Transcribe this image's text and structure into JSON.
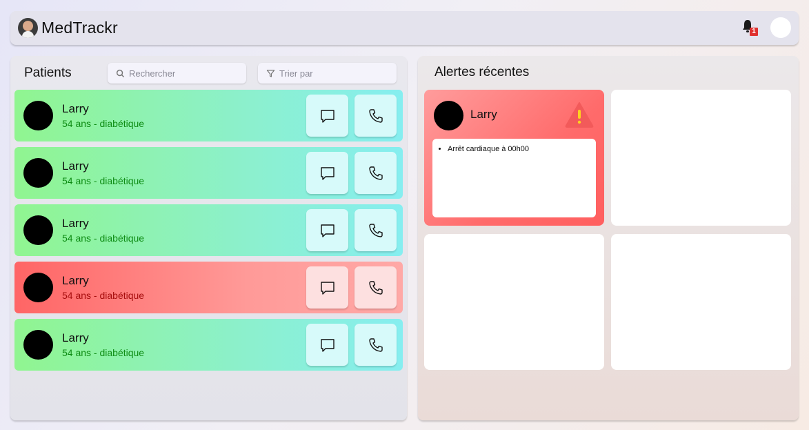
{
  "header": {
    "app_title": "MedTrackr",
    "notification_count": "1"
  },
  "patients": {
    "title": "Patients",
    "search_placeholder": "Rechercher",
    "sort_label": "Trier par",
    "rows": [
      {
        "name": "Larry",
        "info": "54 ans - diabétique",
        "status": "normal"
      },
      {
        "name": "Larry",
        "info": "54 ans - diabétique",
        "status": "normal"
      },
      {
        "name": "Larry",
        "info": "54 ans - diabétique",
        "status": "normal"
      },
      {
        "name": "Larry",
        "info": "54 ans - diabétique",
        "status": "alert"
      },
      {
        "name": "Larry",
        "info": "54 ans - diabétique",
        "status": "normal"
      }
    ]
  },
  "alerts": {
    "title": "Alertes récentes",
    "cards": [
      {
        "name": "Larry",
        "items": [
          "Arrêt cardiaque à 00h00"
        ]
      }
    ]
  },
  "colors": {
    "normal_row": "#90f590",
    "alert_row": "#ff6565",
    "normal_info": "#0e8c14",
    "alert_info": "#a60d0d",
    "badge": "#e0312f"
  },
  "icons": [
    "bell-icon",
    "search-icon",
    "filter-icon",
    "message-icon",
    "phone-icon",
    "warning-icon"
  ]
}
